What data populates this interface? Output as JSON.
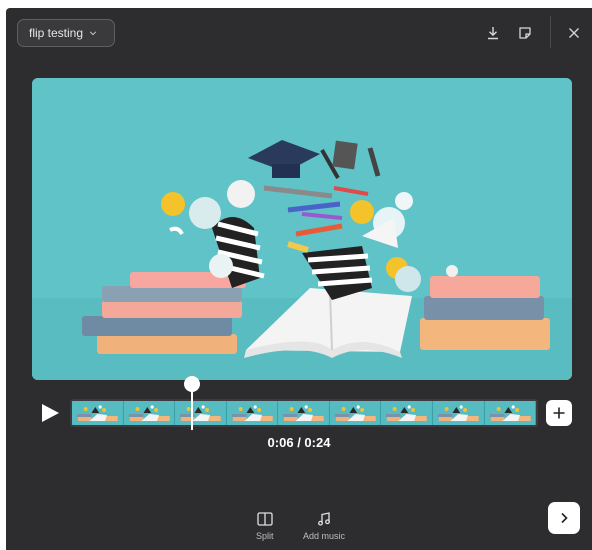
{
  "header": {
    "project_name": "flip testing",
    "icons": [
      "download-icon",
      "sticker-icon",
      "close-icon"
    ]
  },
  "preview": {
    "description_icon": "video-preview"
  },
  "timeline": {
    "current_time": "0:06",
    "separator": " / ",
    "total_time": "0:24",
    "playhead_fraction": 0.25,
    "frame_count": 9
  },
  "tools": [
    {
      "label": "Split",
      "icon": "split-icon"
    },
    {
      "label": "Add music",
      "icon": "music-note-icon"
    }
  ],
  "colors": {
    "panel": "#2d2d2f",
    "preview_bg": "#5fc3c8",
    "accent_white": "#ffffff"
  }
}
